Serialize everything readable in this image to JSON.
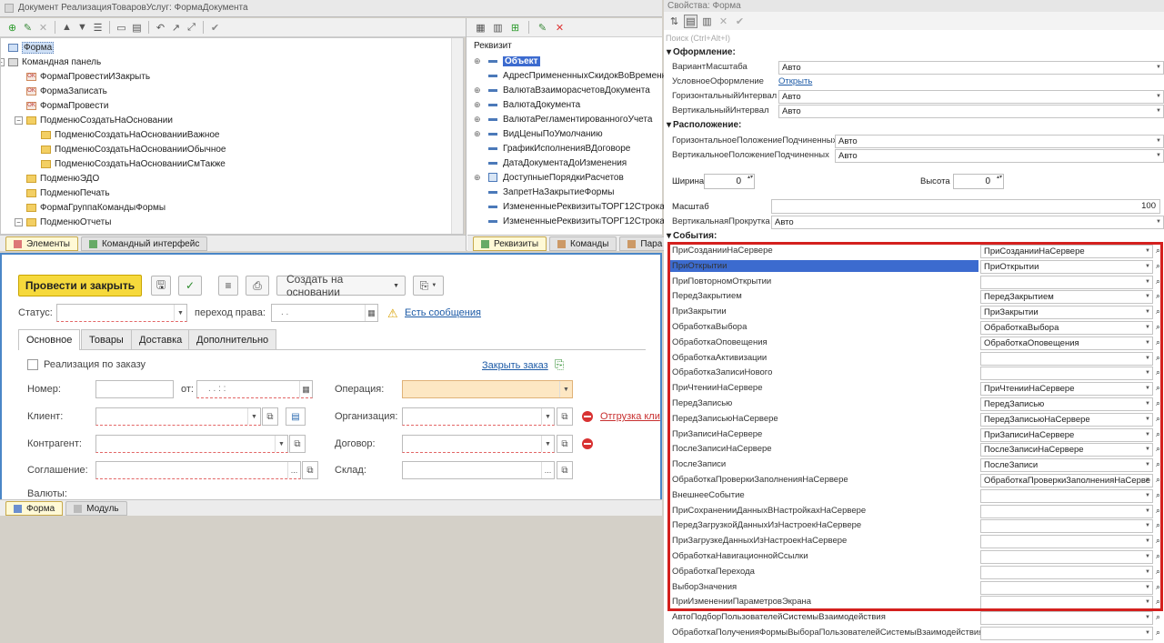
{
  "window_title": "Документ РеализацияТоваровУслуг: ФормаДокумента",
  "elements_tree": [
    {
      "label": "Форма",
      "level": 0,
      "icon": "form-icon",
      "selected": true
    },
    {
      "label": "Командная панель",
      "level": 0,
      "icon": "command-panel-icon",
      "expander": "minus"
    },
    {
      "label": "ФормаПровестиИЗакрыть",
      "level": 1,
      "icon": "ok-button-icon"
    },
    {
      "label": "ФормаЗаписать",
      "level": 1,
      "icon": "ok-button-icon"
    },
    {
      "label": "ФормаПровести",
      "level": 1,
      "icon": "ok-button-icon"
    },
    {
      "label": "ПодменюСоздатьНаОсновании",
      "level": 1,
      "icon": "folder-icon",
      "expander": "minus"
    },
    {
      "label": "ПодменюСоздатьНаОснованииВажное",
      "level": 2,
      "icon": "folder-icon"
    },
    {
      "label": "ПодменюСоздатьНаОснованииОбычное",
      "level": 2,
      "icon": "folder-icon"
    },
    {
      "label": "ПодменюСоздатьНаОснованииСмТакже",
      "level": 2,
      "icon": "folder-icon"
    },
    {
      "label": "ПодменюЭДО",
      "level": 1,
      "icon": "folder-icon"
    },
    {
      "label": "ПодменюПечать",
      "level": 1,
      "icon": "folder-icon"
    },
    {
      "label": "ФормаГруппаКомандыФормы",
      "level": 1,
      "icon": "folder-icon"
    },
    {
      "label": "ПодменюОтчеты",
      "level": 1,
      "icon": "folder-icon",
      "expander": "minus"
    }
  ],
  "left_tabs": [
    "Элементы",
    "Командный интерфейс"
  ],
  "mid_header": "Реквизит",
  "mid_items": [
    {
      "label": "Объект",
      "selected": true,
      "expander": "plus"
    },
    {
      "label": "АдресПримененныхСкидокВоВремення"
    },
    {
      "label": "ВалютаВзаиморасчетовДокумента",
      "expander": "plus"
    },
    {
      "label": "ВалютаДокумента",
      "expander": "plus"
    },
    {
      "label": "ВалютаРегламентированногоУчета",
      "expander": "plus"
    },
    {
      "label": "ВидЦеныПоУмолчанию",
      "expander": "plus"
    },
    {
      "label": "ГрафикИсполненияВДоговоре"
    },
    {
      "label": "ДатаДокументаДоИзменения"
    },
    {
      "label": "ДоступныеПорядкиРасчетов",
      "expander": "plus",
      "icon": "table"
    },
    {
      "label": "ЗапретНаЗакрытиеФормы"
    },
    {
      "label": "ИзмененныеРеквизитыТОРГ12Строка"
    },
    {
      "label": "ИзмененныеРеквизитыТОРГ12Строка"
    }
  ],
  "mid_tabs": [
    "Реквизиты",
    "Команды",
    "Пара"
  ],
  "form": {
    "post_close": "Провести и закрыть",
    "create_based": "Создать на основании",
    "status_label": "Статус:",
    "transfer_label": "переход права:",
    "transfer_value": ". .",
    "messages_link": "Есть сообщения",
    "tabs": [
      "Основное",
      "Товары",
      "Доставка",
      "Дополнительно"
    ],
    "by_order": "Реализация по заказу",
    "close_order": "Закрыть заказ",
    "number_label": "Номер:",
    "from_label": "от:",
    "date_mask": ". .      :  :",
    "operation_label": "Операция:",
    "client_label": "Клиент:",
    "org_label": "Организация:",
    "shipping_link": "Отгрузка кли",
    "counterparty_label": "Контрагент:",
    "contract_label": "Договор:",
    "agreement_label": "Соглашение:",
    "warehouse_label": "Склад:",
    "currencies_label": "Валюты:",
    "ellipsis": "..."
  },
  "bottom_tabs": [
    "Форма",
    "Модуль"
  ],
  "props": {
    "title": "Свойства: Форма",
    "search_placeholder": "Поиск (Ctrl+Alt+I)",
    "sections": {
      "design": "Оформление:",
      "layout": "Расположение:",
      "events": "События:"
    },
    "design_rows": [
      {
        "label": "ВариантМасштаба",
        "value": "Авто"
      },
      {
        "label": "УсловноеОформление",
        "link": "Открыть"
      },
      {
        "label": "ГоризонтальныйИнтервал",
        "value": "Авто"
      },
      {
        "label": "ВертикальныйИнтервал",
        "value": "Авто"
      }
    ],
    "layout_rows": [
      {
        "label": "ГоризонтальноеПоложениеПодчиненных",
        "value": "Авто"
      },
      {
        "label": "ВертикальноеПоложениеПодчиненных",
        "value": "Авто"
      }
    ],
    "width_label": "Ширина",
    "width_value": "0",
    "height_label": "Высота",
    "height_value": "0",
    "scale_label": "Масштаб",
    "scale_value": "100",
    "vscroll_label": "ВертикальнаяПрокрутка",
    "vscroll_value": "Авто",
    "events": [
      {
        "label": "ПриСозданииНаСервере",
        "value": "ПриСозданииНаСервере"
      },
      {
        "label": "ПриОткрытии",
        "value": "ПриОткрытии",
        "selected": true
      },
      {
        "label": "ПриПовторномОткрытии",
        "value": ""
      },
      {
        "label": "ПередЗакрытием",
        "value": "ПередЗакрытием"
      },
      {
        "label": "ПриЗакрытии",
        "value": "ПриЗакрытии"
      },
      {
        "label": "ОбработкаВыбора",
        "value": "ОбработкаВыбора"
      },
      {
        "label": "ОбработкаОповещения",
        "value": "ОбработкаОповещения"
      },
      {
        "label": "ОбработкаАктивизации",
        "value": ""
      },
      {
        "label": "ОбработкаЗаписиНового",
        "value": ""
      },
      {
        "label": "ПриЧтенииНаСервере",
        "value": "ПриЧтенииНаСервере"
      },
      {
        "label": "ПередЗаписью",
        "value": "ПередЗаписью"
      },
      {
        "label": "ПередЗаписьюНаСервере",
        "value": "ПередЗаписьюНаСервере"
      },
      {
        "label": "ПриЗаписиНаСервере",
        "value": "ПриЗаписиНаСервере"
      },
      {
        "label": "ПослеЗаписиНаСервере",
        "value": "ПослеЗаписиНаСервере"
      },
      {
        "label": "ПослеЗаписи",
        "value": "ПослеЗаписи"
      },
      {
        "label": "ОбработкаПроверкиЗаполненияНаСервере",
        "value": "ОбработкаПроверкиЗаполненияНаСерве"
      },
      {
        "label": "ВнешнееСобытие",
        "value": ""
      },
      {
        "label": "ПриСохраненииДанныхВНастройкахНаСервере",
        "value": ""
      },
      {
        "label": "ПередЗагрузкойДанныхИзНастроекНаСервере",
        "value": ""
      },
      {
        "label": "ПриЗагрузкеДанныхИзНастроекНаСервере",
        "value": ""
      },
      {
        "label": "ОбработкаНавигационнойСсылки",
        "value": ""
      },
      {
        "label": "ОбработкаПерехода",
        "value": ""
      },
      {
        "label": "ВыборЗначения",
        "value": ""
      },
      {
        "label": "ПриИзмененииПараметровЭкрана",
        "value": ""
      },
      {
        "label": "АвтоПодборПользователейСистемыВзаимодействия",
        "value": ""
      },
      {
        "label": "ОбработкаПолученияФормыВыбораПользователейСистемыВзаимодействия",
        "value": ""
      }
    ]
  },
  "colors": {
    "highlight_box": "#d4201e",
    "accent_button": "#f6d93c",
    "selection": "#3c6bcf"
  }
}
